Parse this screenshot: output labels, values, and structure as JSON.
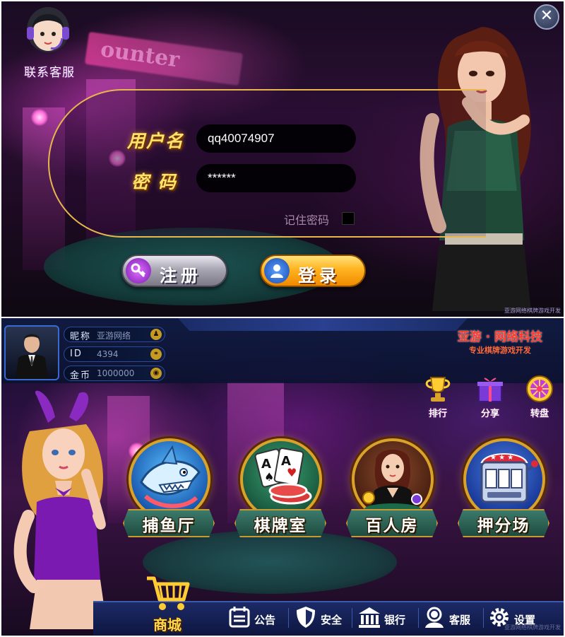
{
  "login": {
    "customer_service_label": "联系客服",
    "close_icon": "close-icon",
    "username_label": "用户名",
    "username_value": "qq40074907",
    "password_label": "密  码",
    "password_value": "******",
    "remember_label": "记住密码",
    "register_label": "注册",
    "login_label": "登录",
    "credit": "亚游网络棋牌游戏开发"
  },
  "lobby": {
    "player": {
      "nickname_label": "昵称",
      "nickname_value": "亚游网络",
      "id_label": "ID",
      "id_value": "4394",
      "coins_label": "金币",
      "coins_value": "1000000"
    },
    "brand": {
      "name": "亚游 · 网络科技",
      "subtitle": "专业棋牌游戏开发"
    },
    "actions": [
      {
        "label": "排行",
        "icon": "trophy-icon"
      },
      {
        "label": "分享",
        "icon": "gift-icon"
      },
      {
        "label": "转盘",
        "icon": "wheel-icon"
      }
    ],
    "games": [
      {
        "label": "捕鱼厅",
        "icon": "shark-icon"
      },
      {
        "label": "棋牌室",
        "icon": "cards-icon"
      },
      {
        "label": "百人房",
        "icon": "dealer-icon"
      },
      {
        "label": "押分场",
        "icon": "slot-machine-icon"
      }
    ],
    "shop_label": "商城",
    "nav": [
      {
        "label": "公告",
        "icon": "notice-icon"
      },
      {
        "label": "安全",
        "icon": "shield-icon"
      },
      {
        "label": "银行",
        "icon": "bank-icon"
      },
      {
        "label": "客服",
        "icon": "support-icon"
      },
      {
        "label": "设置",
        "icon": "gear-icon"
      }
    ],
    "credit": "亚游网络棋牌游戏开发"
  },
  "colors": {
    "gold": "#ffe36a",
    "login_button": "#ffb320",
    "register_button": "#a9a6b3",
    "brand_red": "#ff3a2a"
  }
}
